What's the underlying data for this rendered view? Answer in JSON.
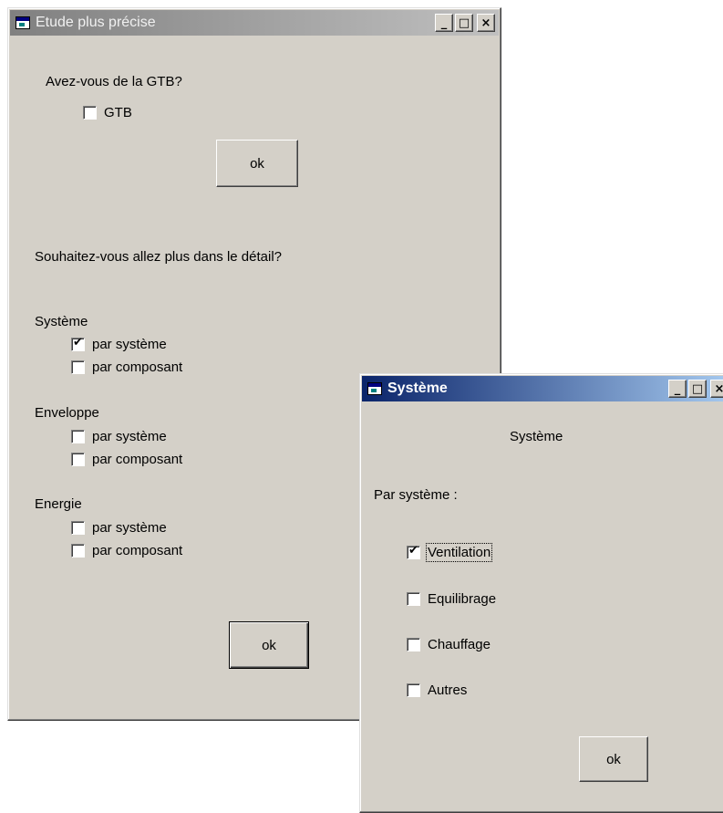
{
  "window_main": {
    "title": "Etude plus précise",
    "question_gtb": "Avez-vous de la GTB?",
    "gtb_checkbox": {
      "label": "GTB",
      "checked": false
    },
    "ok_top": "ok",
    "question_detail": "Souhaitez-vous allez plus dans le détail?",
    "groups": [
      {
        "label": "Système",
        "options": [
          {
            "label": "par système",
            "checked": true
          },
          {
            "label": "par composant",
            "checked": false
          }
        ]
      },
      {
        "label": "Enveloppe",
        "options": [
          {
            "label": "par système",
            "checked": false
          },
          {
            "label": "par composant",
            "checked": false
          }
        ]
      },
      {
        "label": "Energie",
        "options": [
          {
            "label": "par système",
            "checked": false
          },
          {
            "label": "par composant",
            "checked": false
          }
        ]
      }
    ],
    "ok_bottom": "ok",
    "title_buttons": {
      "minimize": "_",
      "maximize": "□",
      "close": "×"
    }
  },
  "window_systeme": {
    "title": "Système",
    "heading": "Système",
    "par_systeme_label": "Par système :",
    "options": [
      {
        "label": "Ventilation",
        "checked": true
      },
      {
        "label": "Equilibrage",
        "checked": false
      },
      {
        "label": "Chauffage",
        "checked": false
      },
      {
        "label": "Autres",
        "checked": false
      }
    ],
    "ok": "ok",
    "title_buttons": {
      "minimize": "_",
      "maximize": "□",
      "close": "×"
    }
  },
  "colors": {
    "face": "#d4d0c8",
    "active_title": "#0a246a",
    "inactive_title": "#808080"
  },
  "icons": {
    "window_icon": "app-window-icon",
    "minimize": "minimize-icon",
    "maximize": "maximize-icon",
    "close": "close-icon"
  }
}
